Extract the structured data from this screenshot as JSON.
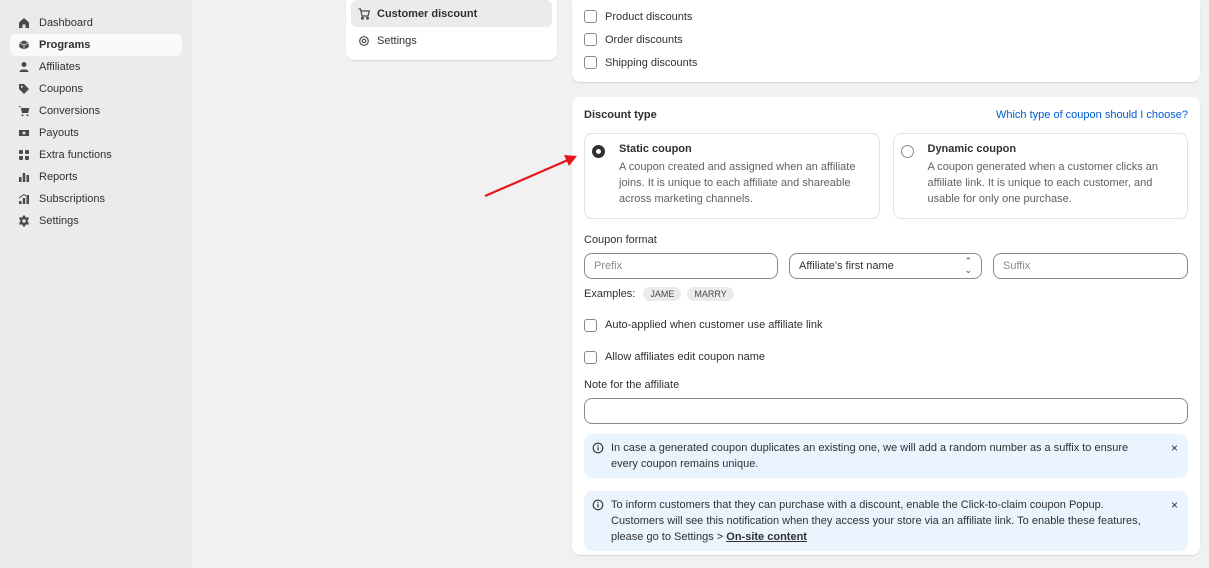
{
  "sidebar": {
    "items": [
      {
        "label": "Dashboard",
        "icon": "home-icon"
      },
      {
        "label": "Programs",
        "icon": "box-icon",
        "active": true
      },
      {
        "label": "Affiliates",
        "icon": "person-icon"
      },
      {
        "label": "Coupons",
        "icon": "tag-icon"
      },
      {
        "label": "Conversions",
        "icon": "cart-icon"
      },
      {
        "label": "Payouts",
        "icon": "cash-icon"
      },
      {
        "label": "Extra functions",
        "icon": "apps-icon"
      },
      {
        "label": "Reports",
        "icon": "chart-icon"
      },
      {
        "label": "Subscriptions",
        "icon": "subscriptions-icon"
      },
      {
        "label": "Settings",
        "icon": "gear-icon"
      }
    ]
  },
  "subnav": {
    "items": [
      {
        "label": "Customer discount",
        "icon": "cart-icon",
        "active": true
      },
      {
        "label": "Settings",
        "icon": "gear-icon"
      }
    ]
  },
  "discount_types": {
    "options": [
      "Product discounts",
      "Order discounts",
      "Shipping discounts"
    ]
  },
  "discount_type": {
    "title": "Discount type",
    "help_link": "Which type of coupon should I choose?",
    "static": {
      "title": "Static coupon",
      "desc": "A coupon created and assigned when an affiliate joins. It is unique to each affiliate and shareable across marketing channels.",
      "selected": true
    },
    "dynamic": {
      "title": "Dynamic coupon",
      "desc": "A coupon generated when a customer clicks an affiliate link. It is unique to each customer, and usable for only one purchase.",
      "selected": false
    }
  },
  "coupon_format": {
    "label": "Coupon format",
    "prefix_placeholder": "Prefix",
    "select_value": "Affiliate's first name",
    "suffix_placeholder": "Suffix",
    "examples_label": "Examples:",
    "examples": [
      "JAME",
      "MARRY"
    ]
  },
  "options": {
    "auto_applied": "Auto-applied when customer use affiliate link",
    "allow_edit": "Allow affiliates edit coupon name"
  },
  "note": {
    "label": "Note for the affiliate",
    "value": ""
  },
  "banners": {
    "duplicate": "In case a generated coupon duplicates an existing one, we will add a random number as a suffix to ensure every coupon remains unique.",
    "popup_text": "To inform customers that they can purchase with a discount, enable the Click-to-claim coupon Popup. Customers will see this notification when they access your store via an affiliate link. To enable these features, please go to Settings >",
    "popup_link": "On-site content",
    "close_glyph": "×"
  },
  "colors": {
    "accent_link": "#005bd3",
    "banner_bg": "#eaf4ff",
    "annotation_arrow": "#e8151b"
  }
}
